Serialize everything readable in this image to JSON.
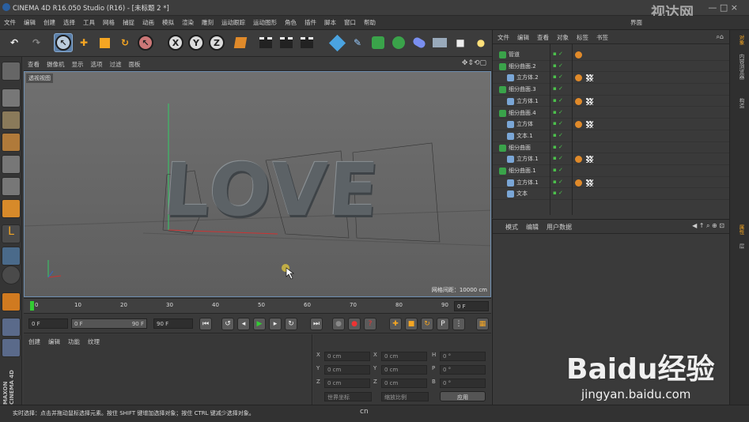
{
  "window": {
    "title": "CINEMA 4D R16.050 Studio (R16) - [未标题 2 *]",
    "controls": "— □ ×"
  },
  "menu": [
    "文件",
    "编辑",
    "创建",
    "选择",
    "工具",
    "网格",
    "捕捉",
    "动画",
    "模拟",
    "渲染",
    "雕刻",
    "运动跟踪",
    "运动图形",
    "角色",
    "插件",
    "脚本",
    "窗口",
    "帮助"
  ],
  "menu_right": "界面",
  "viewport_menu": [
    "查看",
    "摄像机",
    "显示",
    "选项",
    "过滤",
    "面板"
  ],
  "viewport_label": "透视视图",
  "viewport_text": "LOVE",
  "grid_info": "网格间距：10000 cm",
  "timeline_ticks": [
    "0",
    "10",
    "20",
    "30",
    "40",
    "50",
    "60",
    "70",
    "80",
    "90"
  ],
  "timeline_frame": "0 F",
  "playbar": {
    "start": "0 F",
    "range_a": "0 F",
    "range_b": "90 F",
    "end": "90 F"
  },
  "material_menu": [
    "创建",
    "编辑",
    "功能",
    "纹理"
  ],
  "coords": {
    "rows": [
      {
        "a": "X",
        "v1": "0 cm",
        "b": "X",
        "v2": "0 cm",
        "c": "H",
        "v3": "0 °"
      },
      {
        "a": "Y",
        "v1": "0 cm",
        "b": "Y",
        "v2": "0 cm",
        "c": "P",
        "v3": "0 °"
      },
      {
        "a": "Z",
        "v1": "0 cm",
        "b": "Z",
        "v2": "0 cm",
        "c": "B",
        "v3": "0 °"
      }
    ],
    "dropdown1": "世界坐标",
    "dropdown2": "缩放比例",
    "apply": "应用"
  },
  "object_menu": [
    "文件",
    "编辑",
    "查看",
    "对象",
    "标签",
    "书签"
  ],
  "objects": [
    {
      "name": "管道",
      "indent": 0
    },
    {
      "name": "细分曲面.2",
      "indent": 0
    },
    {
      "name": "立方体.2",
      "indent": 1
    },
    {
      "name": "细分曲面.3",
      "indent": 0
    },
    {
      "name": "立方体.1",
      "indent": 1
    },
    {
      "name": "细分曲面.4",
      "indent": 0
    },
    {
      "name": "立方体",
      "indent": 1
    },
    {
      "name": "文本.1",
      "indent": 1
    },
    {
      "name": "细分曲面",
      "indent": 0
    },
    {
      "name": "立方体.1",
      "indent": 1
    },
    {
      "name": "细分曲面.1",
      "indent": 0
    },
    {
      "name": "立方体.1",
      "indent": 1
    },
    {
      "name": "文本",
      "indent": 1
    }
  ],
  "attr_menu": [
    "模式",
    "编辑",
    "用户数据"
  ],
  "right_tabs": [
    "对象",
    "内容浏览器",
    "构造",
    "属性",
    "层"
  ],
  "status": "实时选择：点击并拖动鼠标选择元素。按住 SHIFT 键增加选择对象；按住 CTRL 键减少选择对象。",
  "watermark": {
    "top": "视达网",
    "brand": "Baidu经验",
    "url": "jingyan.baidu.com",
    "mid": "cn"
  },
  "maxon": "MAXON CINEMA 4D",
  "colors": {
    "accent": "#5b7fa8",
    "viewport_border": "#6f8fb0",
    "green_check": "#4cc24c"
  }
}
